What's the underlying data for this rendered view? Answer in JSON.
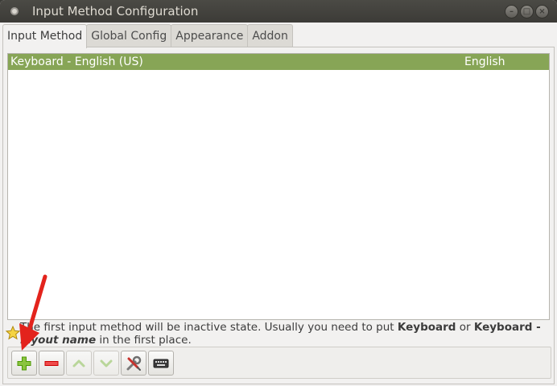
{
  "window": {
    "title": "Input Method Configuration"
  },
  "tabs": [
    {
      "label": "Input Method",
      "active": true
    },
    {
      "label": "Global Config",
      "active": false
    },
    {
      "label": "Appearance",
      "active": false
    },
    {
      "label": "Addon",
      "active": false
    }
  ],
  "input_methods": [
    {
      "name": "Keyboard - English (US)",
      "language": "English",
      "selected": true
    }
  ],
  "info": {
    "icon": "star-icon",
    "text_1": "The first input method will be inactive state. Usually you need to put ",
    "bold_1": "Keyboard",
    "text_2": " or ",
    "bold_2": "Keyboard - ",
    "bold_italic": "layout name",
    "text_3": " in the first place."
  },
  "toolbar": {
    "buttons": [
      {
        "name": "add",
        "icon": "plus-icon",
        "enabled": true
      },
      {
        "name": "remove",
        "icon": "minus-icon",
        "enabled": true
      },
      {
        "name": "move-up",
        "icon": "chevron-up-icon",
        "enabled": false
      },
      {
        "name": "move-down",
        "icon": "chevron-down-icon",
        "enabled": false
      },
      {
        "name": "configure",
        "icon": "wrench-screwdriver-icon",
        "enabled": true
      },
      {
        "name": "keyboard-layout",
        "icon": "keyboard-icon",
        "enabled": true
      }
    ]
  },
  "colors": {
    "selection": "#87a556",
    "annotation_arrow": "#e3231c",
    "add_green": "#4e9a06",
    "remove_red": "#cc0000"
  }
}
